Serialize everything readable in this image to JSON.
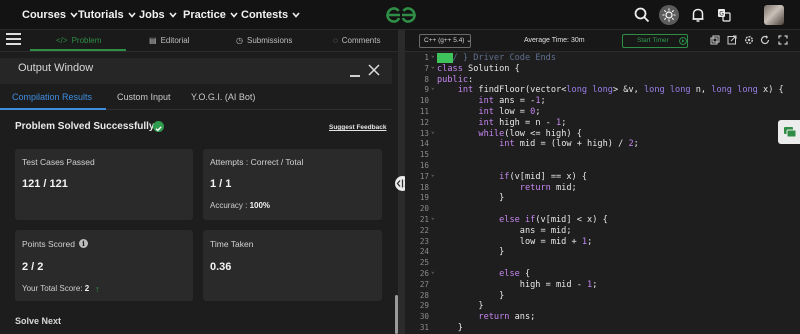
{
  "nav": {
    "items": [
      {
        "label": "Courses"
      },
      {
        "label": "Tutorials"
      },
      {
        "label": "Jobs"
      },
      {
        "label": "Practice"
      },
      {
        "label": "Contests"
      }
    ],
    "colors": {
      "brand": "#2f8d46",
      "accent": "#3f8fe0"
    }
  },
  "problem_tabs": [
    {
      "label": "Problem",
      "icon": "code-icon",
      "active": true
    },
    {
      "label": "Editorial",
      "icon": "document-icon"
    },
    {
      "label": "Submissions",
      "icon": "clock-icon"
    },
    {
      "label": "Comments",
      "icon": "comment-icon"
    }
  ],
  "output": {
    "title": "Output Window",
    "tabs": [
      {
        "label": "Compilation Results",
        "active": true
      },
      {
        "label": "Custom Input"
      },
      {
        "label": "Y.O.G.I. (AI Bot)"
      }
    ],
    "status": "Problem Solved Successfully",
    "feedback": "Suggest Feedback",
    "test_cases": {
      "label": "Test Cases Passed",
      "value": "121 / 121"
    },
    "attempts": {
      "label": "Attempts : Correct / Total",
      "value": "1 / 1",
      "accuracy_label": "Accuracy :",
      "accuracy_value": "100%"
    },
    "points": {
      "label": "Points Scored",
      "value": "2 / 2",
      "total_label": "Your Total Score:",
      "total_value": "2"
    },
    "time": {
      "label": "Time Taken",
      "value": "0.36"
    },
    "solve_next": "Solve Next"
  },
  "editor": {
    "language": "C++ (g++ 5.4)",
    "avg_time": "Average Time: 30m",
    "timer": "Start Timer",
    "lines": [
      {
        "n": "1",
        "fold": "⌄",
        "html": "<span class='sel'>///</span><span class='cm'>/ } Driver Code Ends</span>"
      },
      {
        "n": "7",
        "fold": "⌄",
        "html": "<span class='kw'>class</span> Solution {"
      },
      {
        "n": "8",
        "fold": "",
        "html": "<span class='kw'>public</span>:"
      },
      {
        "n": "9",
        "fold": "⌄",
        "html": "    <span class='kw'>int</span> findFloor(vector&lt;<span class='ty'>long long</span>&gt; &amp;v, <span class='ty'>long long</span> n, <span class='ty'>long long</span> x) {"
      },
      {
        "n": "10",
        "fold": "",
        "html": "        <span class='kw'>int</span> ans = -<span class='num'>1</span>;"
      },
      {
        "n": "11",
        "fold": "",
        "html": "        <span class='kw'>int</span> low = <span class='num'>0</span>;"
      },
      {
        "n": "12",
        "fold": "",
        "html": "        <span class='kw'>int</span> high = n - <span class='num'>1</span>;"
      },
      {
        "n": "13",
        "fold": "⌄",
        "html": "        <span class='kw'>while</span>(low &lt;= high) {"
      },
      {
        "n": "14",
        "fold": "",
        "html": "            <span class='kw'>int</span> mid = (low + high) / <span class='num'>2</span>;"
      },
      {
        "n": "15",
        "fold": "",
        "html": ""
      },
      {
        "n": "16",
        "fold": "",
        "html": ""
      },
      {
        "n": "17",
        "fold": "⌄",
        "html": "            <span class='kw'>if</span>(v[mid] == x) {"
      },
      {
        "n": "18",
        "fold": "",
        "html": "                <span class='kw'>return</span> mid;"
      },
      {
        "n": "19",
        "fold": "",
        "html": "            }"
      },
      {
        "n": "20",
        "fold": "",
        "html": ""
      },
      {
        "n": "21",
        "fold": "⌄",
        "html": "            <span class='kw'>else if</span>(v[mid] &lt; x) {"
      },
      {
        "n": "22",
        "fold": "",
        "html": "                ans = mid;"
      },
      {
        "n": "23",
        "fold": "",
        "html": "                low = mid + <span class='num'>1</span>;"
      },
      {
        "n": "24",
        "fold": "",
        "html": "            }"
      },
      {
        "n": "25",
        "fold": "",
        "html": ""
      },
      {
        "n": "26",
        "fold": "⌄",
        "html": "            <span class='kw'>else</span> {"
      },
      {
        "n": "27",
        "fold": "",
        "html": "                high = mid - <span class='num'>1</span>;"
      },
      {
        "n": "28",
        "fold": "",
        "html": "            }"
      },
      {
        "n": "29",
        "fold": "",
        "html": "        }"
      },
      {
        "n": "30",
        "fold": "",
        "html": "        <span class='kw'>return</span> ans;"
      },
      {
        "n": "31",
        "fold": "",
        "html": "    }"
      }
    ]
  }
}
